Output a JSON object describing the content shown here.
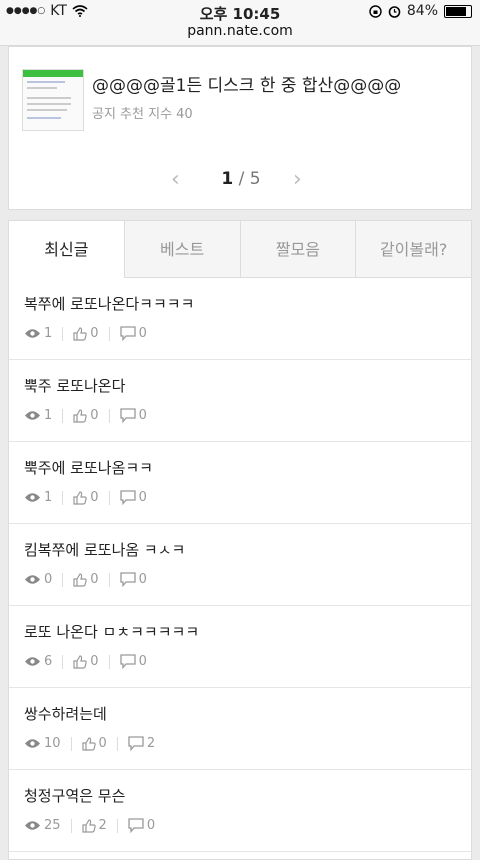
{
  "status": {
    "carrier": "KT",
    "time": "오후 10:45",
    "battery_pct": 84,
    "battery_label": "84%"
  },
  "url": "pann.nate.com",
  "featured": {
    "title": "@@@@골1든 디스크 한 중 합산@@@@",
    "meta": "공지 추천 지수 40",
    "pager": {
      "current": "1",
      "sep": " / ",
      "total": "5"
    }
  },
  "tabs": [
    {
      "label": "최신글",
      "active": true
    },
    {
      "label": "베스트",
      "active": false
    },
    {
      "label": "짤모음",
      "active": false
    },
    {
      "label": "같이볼래?",
      "active": false
    }
  ],
  "posts": [
    {
      "title": "복쭈에 로또나온다ㅋㅋㅋㅋ",
      "views": "1",
      "likes": "0",
      "comments": "0"
    },
    {
      "title": "뿍주 로또나온다",
      "views": "1",
      "likes": "0",
      "comments": "0"
    },
    {
      "title": "뿍주에 로또나옴ㅋㅋ",
      "views": "1",
      "likes": "0",
      "comments": "0"
    },
    {
      "title": "킴복쭈에 로또나옴 ㅋㅅㅋ",
      "views": "0",
      "likes": "0",
      "comments": "0"
    },
    {
      "title": "로또 나온다 ㅁㅊㅋㅋㅋㅋㅋ",
      "views": "6",
      "likes": "0",
      "comments": "0"
    },
    {
      "title": "쌍수하려는데",
      "views": "10",
      "likes": "0",
      "comments": "2"
    },
    {
      "title": "청정구역은 무슨",
      "views": "25",
      "likes": "2",
      "comments": "0"
    }
  ]
}
